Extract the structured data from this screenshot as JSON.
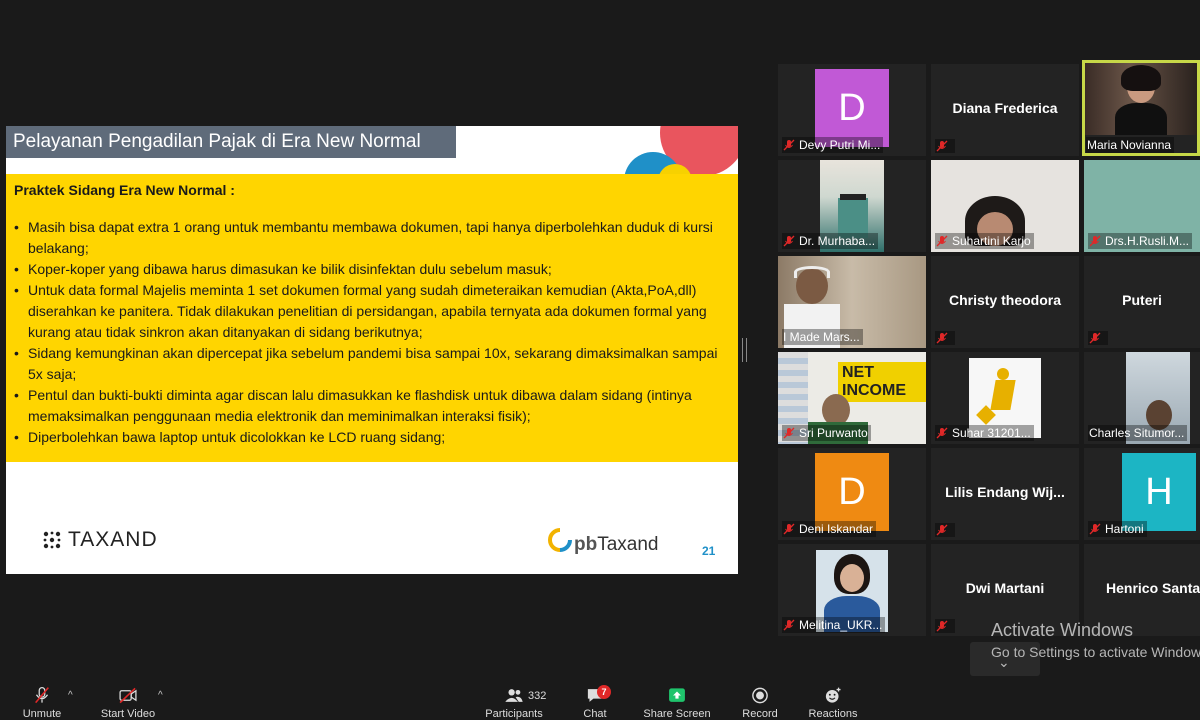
{
  "slide": {
    "title": "Pelayanan Pengadilan Pajak di Era New Normal",
    "section_heading": "Praktek Sidang Era New Normal :",
    "bullets": [
      "Masih bisa dapat extra 1 orang untuk membantu membawa dokumen, tapi hanya diperbolehkan duduk di kursi belakang;",
      "Koper-koper yang dibawa harus dimasukan ke bilik disinfektan dulu sebelum masuk;",
      "Untuk data formal Majelis meminta 1 set dokumen formal yang sudah dimeteraikan kemudian (Akta,PoA,dll) diserahkan ke panitera. Tidak dilakukan penelitian di persidangan, apabila ternyata ada dokumen formal yang kurang atau tidak sinkron akan ditanyakan di sidang berikutnya;",
      "Sidang  kemungkinan akan dipercepat jika sebelum pandemi bisa sampai 10x, sekarang dimaksimalkan sampai 5x saja;",
      "Pentul dan bukti-bukti diminta agar discan lalu dimasukkan ke flashdisk untuk dibawa dalam sidang (intinya memaksimalkan penggunaan media elektronik dan meminimalkan interaksi fisik);",
      "Diperbolehkan bawa laptop untuk dicolokkan ke LCD ruang sidang;"
    ],
    "bullet_glyph": "•",
    "logo_left": "TAXAND",
    "logo_right_prefix": "pb",
    "logo_right_main": "Taxand",
    "page_number": "21"
  },
  "participants": {
    "devy": {
      "name": "Devy Putri Mi...",
      "avatar_letter": "D",
      "avatar_color": "#c159d6"
    },
    "diana": {
      "name": "Diana Frederica"
    },
    "maria": {
      "name": "Maria Novianna"
    },
    "murhaba": {
      "name": "Dr. Murhaba..."
    },
    "suhartini": {
      "name": "Suhartini Karjo"
    },
    "rusli": {
      "name": "Drs.H.Rusli.M..."
    },
    "imade": {
      "name": "I Made Mars..."
    },
    "christy": {
      "name": "Christy theodora"
    },
    "puteri": {
      "name": "Puteri"
    },
    "sri": {
      "name": "Sri Purwanto",
      "video_text": "NET INCOME"
    },
    "suhar": {
      "name": "Suhar 31201..."
    },
    "charles": {
      "name": "Charles Situmor..."
    },
    "deni": {
      "name": "Deni Iskandar",
      "avatar_letter": "D",
      "avatar_color": "#ef8a12"
    },
    "lilis": {
      "name": "Lilis  Endang  Wij..."
    },
    "hartoni": {
      "name": "Hartoni",
      "avatar_letter": "H",
      "avatar_color": "#1cb5c4"
    },
    "melitina": {
      "name": "Melitina_UKR..."
    },
    "dwi": {
      "name": "Dwi Martani"
    },
    "henrico": {
      "name": "Henrico Santar"
    }
  },
  "watermark": {
    "line1": "Activate Windows",
    "line2": "Go to Settings to activate Window"
  },
  "toolbar": {
    "unmute": "Unmute",
    "start_video": "Start Video",
    "participants_label": "Participants",
    "participants_count": "332",
    "chat_label": "Chat",
    "chat_badge": "7",
    "share_label": "Share Screen",
    "record_label": "Record",
    "reactions_label": "Reactions",
    "caret": "^"
  },
  "colors": {
    "accent_green": "#1fc46c",
    "active_border": "#c7d848",
    "mic_off_red": "#e02828"
  }
}
